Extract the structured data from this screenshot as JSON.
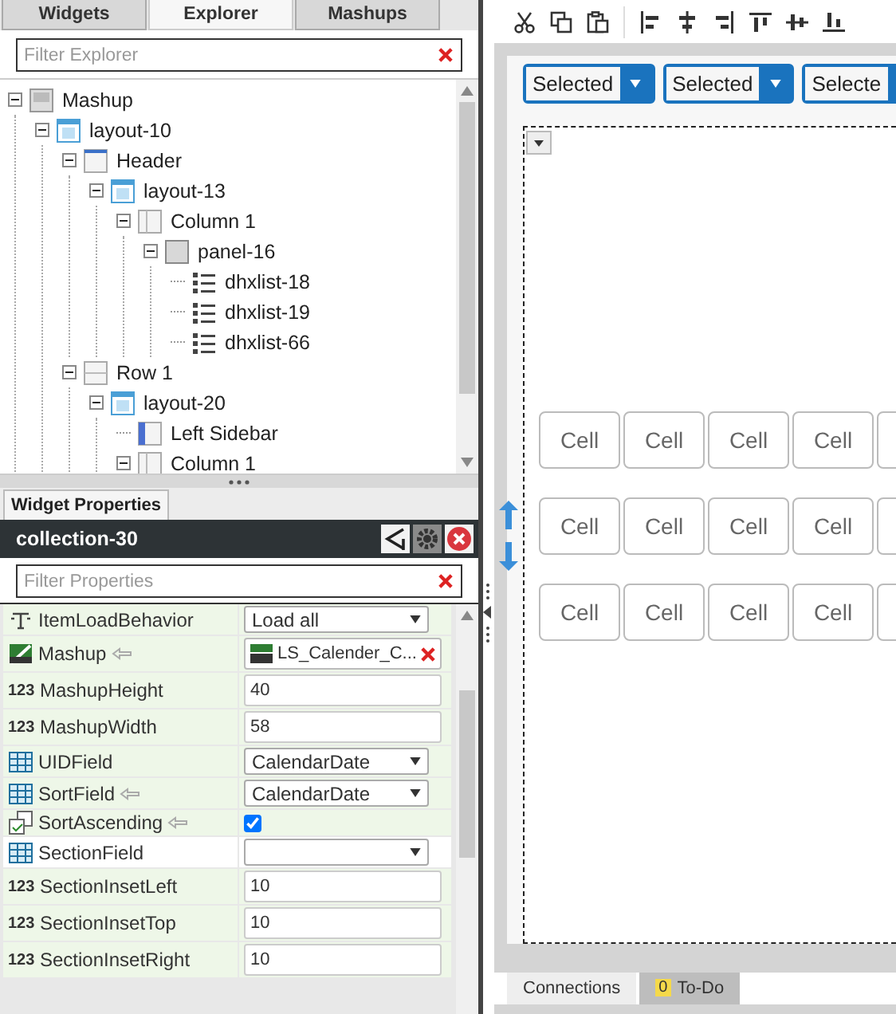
{
  "left_tabs": [
    {
      "label": "Widgets",
      "selected": false
    },
    {
      "label": "Explorer",
      "selected": true
    },
    {
      "label": "Mashups",
      "selected": false
    }
  ],
  "explorer_filter": {
    "placeholder": "Filter Explorer"
  },
  "tree": [
    {
      "label": "Mashup",
      "kind": "mashup",
      "expanded": true,
      "children": [
        {
          "label": "layout-10",
          "kind": "layout",
          "expanded": true,
          "children": [
            {
              "label": "Header",
              "kind": "header",
              "expanded": true,
              "children": [
                {
                  "label": "layout-13",
                  "kind": "layout",
                  "expanded": true,
                  "children": [
                    {
                      "label": "Column 1",
                      "kind": "column",
                      "expanded": true,
                      "children": [
                        {
                          "label": "panel-16",
                          "kind": "panel",
                          "expanded": true,
                          "children": [
                            {
                              "label": "dhxlist-18",
                              "kind": "list"
                            },
                            {
                              "label": "dhxlist-19",
                              "kind": "list"
                            },
                            {
                              "label": "dhxlist-66",
                              "kind": "list"
                            }
                          ]
                        }
                      ]
                    }
                  ]
                }
              ]
            },
            {
              "label": "Row 1",
              "kind": "row",
              "expanded": true,
              "children": [
                {
                  "label": "layout-20",
                  "kind": "layout",
                  "expanded": true,
                  "children": [
                    {
                      "label": "Left Sidebar",
                      "kind": "sidebar"
                    },
                    {
                      "label": "Column 1",
                      "kind": "column",
                      "expanded": true
                    }
                  ]
                }
              ]
            }
          ]
        }
      ]
    }
  ],
  "properties_tab": {
    "label": "Widget Properties"
  },
  "widget": {
    "title": "collection-30"
  },
  "properties_filter": {
    "placeholder": "Filter Properties"
  },
  "properties": [
    {
      "name": "ItemLoadBehavior",
      "kind": "string",
      "bound": false,
      "selected": false,
      "editor": {
        "kind": "select",
        "value": "Load all"
      }
    },
    {
      "name": "Mashup",
      "kind": "mashup",
      "bound": true,
      "selected": false,
      "editor": {
        "kind": "mashup",
        "value": "LS_Calender_C..."
      }
    },
    {
      "name": "MashupHeight",
      "kind": "number",
      "type_label": "123",
      "bound": false,
      "selected": false,
      "editor": {
        "kind": "input",
        "value": "40"
      }
    },
    {
      "name": "MashupWidth",
      "kind": "number",
      "type_label": "123",
      "bound": false,
      "selected": false,
      "editor": {
        "kind": "input",
        "value": "58"
      }
    },
    {
      "name": "UIDField",
      "kind": "field",
      "bound": false,
      "selected": false,
      "editor": {
        "kind": "select",
        "value": "CalendarDate"
      }
    },
    {
      "name": "SortField",
      "kind": "field",
      "bound": true,
      "selected": false,
      "editor": {
        "kind": "select",
        "value": "CalendarDate"
      }
    },
    {
      "name": "SortAscending",
      "kind": "boolean",
      "bound": true,
      "selected": false,
      "editor": {
        "kind": "checkbox",
        "checked": true
      }
    },
    {
      "name": "SectionField",
      "kind": "field",
      "bound": false,
      "selected": true,
      "editor": {
        "kind": "select"
      }
    },
    {
      "name": "SectionInsetLeft",
      "kind": "number",
      "type_label": "123",
      "bound": false,
      "selected": false,
      "editor": {
        "kind": "input",
        "value": "10"
      }
    },
    {
      "name": "SectionInsetTop",
      "kind": "number",
      "type_label": "123",
      "bound": false,
      "selected": false,
      "editor": {
        "kind": "input",
        "value": "10"
      }
    },
    {
      "name": "SectionInsetRight",
      "kind": "number",
      "type_label": "123",
      "bound": false,
      "selected": false,
      "editor": {
        "kind": "input",
        "value": "10"
      }
    }
  ],
  "dropdowns": [
    {
      "label": "Selected"
    },
    {
      "label": "Selected"
    },
    {
      "label": "Selecte"
    }
  ],
  "cell_grid": [
    [
      "Cell",
      "Cell",
      "Cell",
      "Cell"
    ],
    [
      "Cell",
      "Cell",
      "Cell",
      "Cell"
    ],
    [
      "Cell",
      "Cell",
      "Cell",
      "Cell"
    ]
  ],
  "bottom_tabs": [
    {
      "label": "Connections",
      "selected": true
    },
    {
      "label": "To-Do",
      "selected": false,
      "badge": "0"
    }
  ]
}
